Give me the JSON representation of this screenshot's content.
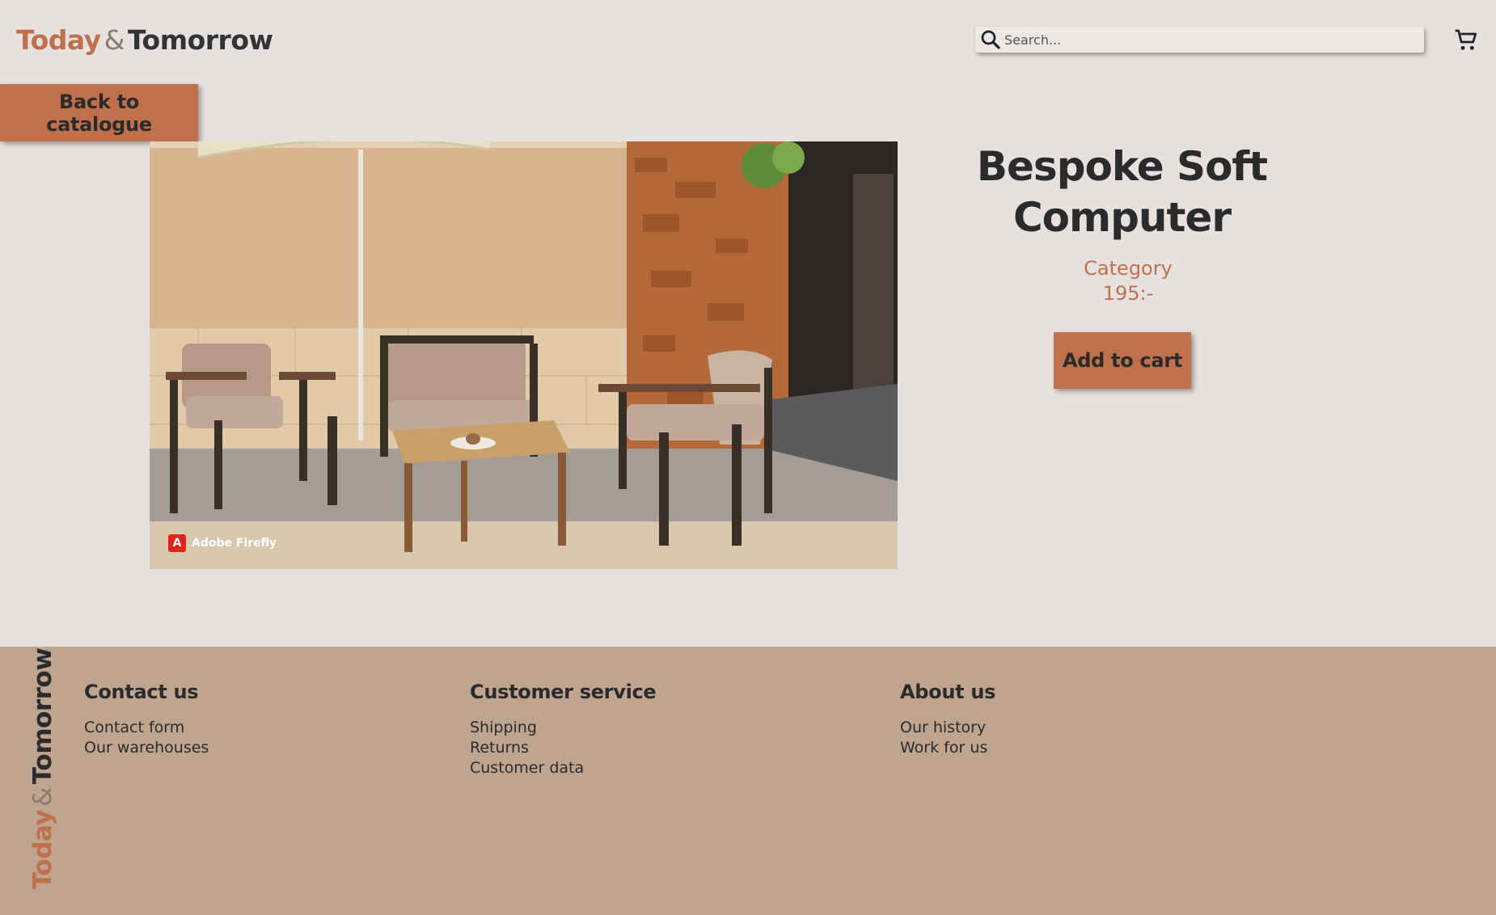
{
  "header": {
    "logo": {
      "word1": "Today",
      "amp": "&",
      "word2": "Tomorrow"
    },
    "search": {
      "placeholder": "Search...",
      "value": "",
      "icon": "search-icon"
    },
    "cart_icon": "cart-icon"
  },
  "nav": {
    "back_label": "Back to catalogue"
  },
  "product": {
    "title": "Bespoke Soft Computer",
    "category": "Category",
    "price": "195:-",
    "add_to_cart_label": "Add to cart",
    "image_watermark": "Adobe Firefly"
  },
  "footer": {
    "logo": {
      "word1": "Today",
      "amp": "&",
      "word2": "Tomorrow"
    },
    "columns": [
      {
        "heading": "Contact us",
        "links": [
          "Contact form",
          "Our warehouses"
        ]
      },
      {
        "heading": "Customer service",
        "links": [
          "Shipping",
          "Returns",
          "Customer data"
        ]
      },
      {
        "heading": "About us",
        "links": [
          "Our history",
          "Work for us"
        ]
      }
    ]
  },
  "colors": {
    "background": "#e6e1df",
    "accent": "#c0704a",
    "footer_bg": "#bfa48f",
    "text": "#2b2b2b"
  }
}
